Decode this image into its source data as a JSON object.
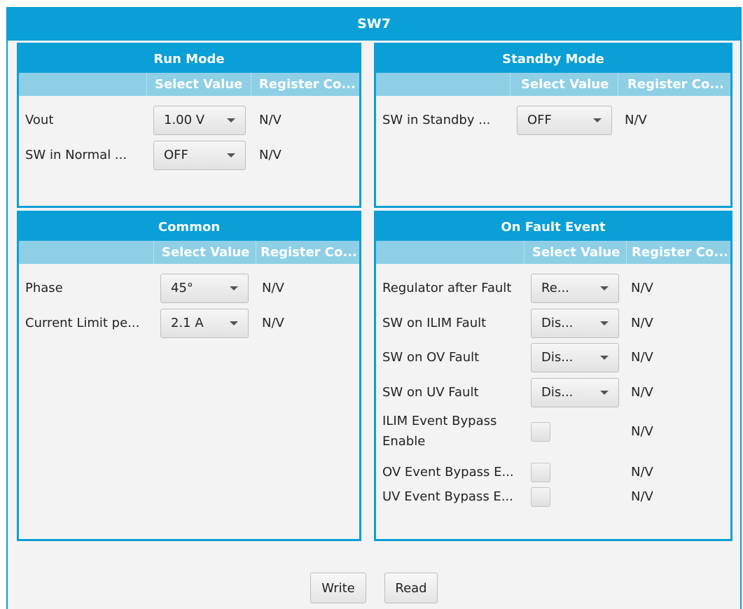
{
  "title": "SW7",
  "run_mode": {
    "title": "Run Mode",
    "col_select": "Select Value",
    "col_register": "Register Co...",
    "rows": [
      {
        "label": "Vout",
        "value": "1.00 V",
        "register": "N/V"
      },
      {
        "label": "SW in Normal ...",
        "value": "OFF",
        "register": "N/V"
      }
    ]
  },
  "standby_mode": {
    "title": "Standby Mode",
    "col_select": "Select Value",
    "col_register": "Register Co...",
    "rows": [
      {
        "label": "SW in Standby ...",
        "value": "OFF",
        "register": "N/V"
      }
    ]
  },
  "common": {
    "title": "Common",
    "col_select": "Select Value",
    "col_register": "Register Co...",
    "rows": [
      {
        "label": "Phase",
        "value": "45°",
        "register": "N/V"
      },
      {
        "label": "Current Limit pe...",
        "value": "2.1 A",
        "register": "N/V"
      }
    ]
  },
  "on_fault_event": {
    "title": "On Fault Event",
    "col_select": "Select Value",
    "col_register": "Register Co...",
    "rows": [
      {
        "label": "Regulator after Fault",
        "value": "Re...",
        "register": "N/V"
      },
      {
        "label": "SW on ILIM Fault",
        "value": "Dis...",
        "register": "N/V"
      },
      {
        "label": "SW on OV Fault",
        "value": "Dis...",
        "register": "N/V"
      },
      {
        "label": "SW on UV Fault",
        "value": "Dis...",
        "register": "N/V"
      }
    ],
    "checks": [
      {
        "label": "ILIM Event Bypass Enable",
        "checked": false,
        "register": "N/V"
      },
      {
        "label": "OV Event Bypass E...",
        "checked": false,
        "register": "N/V"
      },
      {
        "label": "UV Event Bypass E...",
        "checked": false,
        "register": "N/V"
      }
    ]
  },
  "buttons": {
    "write": "Write",
    "read": "Read"
  }
}
